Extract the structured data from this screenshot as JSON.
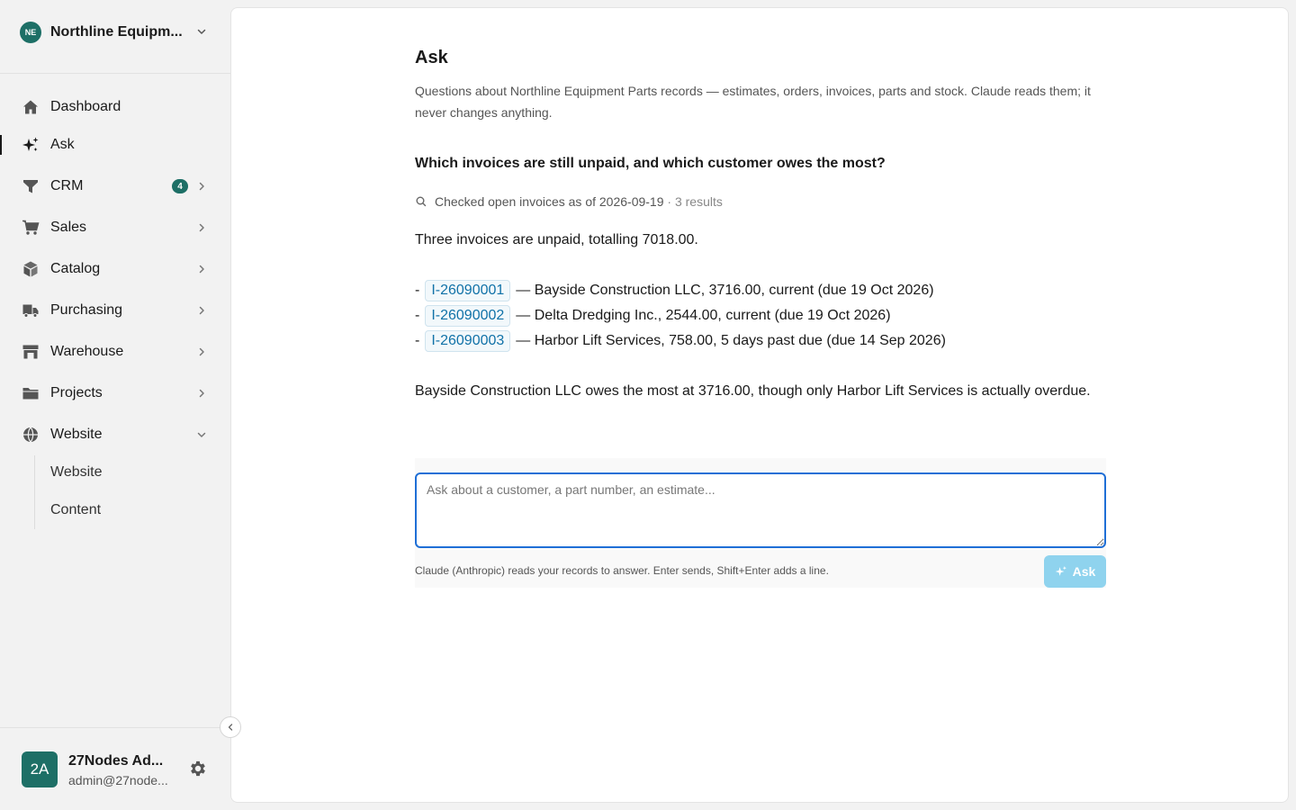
{
  "org": {
    "initials": "NE",
    "name": "Northline Equipm..."
  },
  "nav": {
    "items": [
      {
        "label": "Dashboard",
        "icon": "home-icon"
      },
      {
        "label": "Ask",
        "icon": "sparkles-icon"
      },
      {
        "label": "CRM",
        "icon": "funnel-icon",
        "badge": "4"
      },
      {
        "label": "Sales",
        "icon": "cart-icon"
      },
      {
        "label": "Catalog",
        "icon": "box-icon"
      },
      {
        "label": "Purchasing",
        "icon": "truck-icon"
      },
      {
        "label": "Warehouse",
        "icon": "warehouse-icon"
      },
      {
        "label": "Projects",
        "icon": "folder-icon"
      },
      {
        "label": "Website",
        "icon": "globe-icon"
      }
    ],
    "website_sub": [
      "Website",
      "Content"
    ]
  },
  "user": {
    "initials": "2A",
    "name": "27Nodes Ad...",
    "email": "admin@27node..."
  },
  "page": {
    "title": "Ask",
    "description": "Questions about Northline Equipment Parts records — estimates, orders, invoices, parts and stock. Claude reads them; it never changes anything."
  },
  "conversation": {
    "question": "Which invoices are still unpaid, and which customer owes the most?",
    "tool_text": "Checked open invoices as of 2026-09-19",
    "tool_sep": " · ",
    "tool_count": "3 results",
    "intro": "Three invoices are unpaid, totalling 7018.00.",
    "invoices": [
      {
        "id": "I-26090001",
        "text": "— Bayside Construction LLC, 3716.00, current (due 19 Oct 2026)"
      },
      {
        "id": "I-26090002",
        "text": "— Delta Dredging Inc., 2544.00, current (due 19 Oct 2026)"
      },
      {
        "id": "I-26090003",
        "text": "— Harbor Lift Services, 758.00, 5 days past due (due 14 Sep 2026)"
      }
    ],
    "bullet": "-",
    "summary": "Bayside Construction LLC owes the most at 3716.00, though only Harbor Lift Services is actually overdue."
  },
  "composer": {
    "placeholder": "Ask about a customer, a part number, an estimate...",
    "hint": "Claude (Anthropic) reads your records to answer. Enter sends, Shift+Enter adds a line.",
    "button": "Ask"
  },
  "colors": {
    "accent": "#1d6f66",
    "link": "#1172a8",
    "focus": "#1f6fd6",
    "ask_button": "#8fd3ee"
  }
}
